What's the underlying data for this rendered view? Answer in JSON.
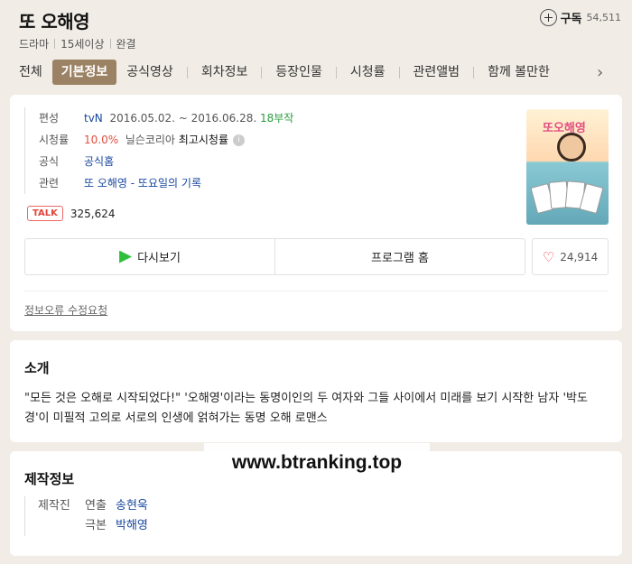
{
  "header": {
    "title": "또 오해영",
    "meta": [
      "드라마",
      "15세이상",
      "완결"
    ],
    "subscribe": {
      "label": "구독",
      "count": "54,511"
    }
  },
  "tabs": [
    "전체",
    "기본정보",
    "공식영상",
    "회차정보",
    "등장인물",
    "시청률",
    "관련앨범",
    "함께 볼만한"
  ],
  "active_tab": "기본정보",
  "info": {
    "broadcast": {
      "label": "편성",
      "channel": "tvN",
      "period": "2016.05.02. ~ 2016.06.28.",
      "episodes": "18부작"
    },
    "rating": {
      "label": "시청률",
      "value": "10.0%",
      "source": "닐슨코리아",
      "note": "최고시청률"
    },
    "official": {
      "label": "공식",
      "link": "공식홈"
    },
    "related": {
      "label": "관련",
      "link": "또 오해영 - 또요일의 기록"
    }
  },
  "talk": {
    "badge": "TALK",
    "count": "325,624"
  },
  "poster": {
    "title": "또오해영"
  },
  "actions": {
    "rewatch": "다시보기",
    "program_home": "프로그램 홈",
    "likes": "24,914"
  },
  "report_link": "정보오류 수정요청",
  "intro": {
    "title": "소개",
    "text": "\"모든 것은 오해로 시작되었다!\" '오해영'이라는 동명이인의 두 여자와 그들 사이에서 미래를 보기 시작한 남자 '박도경'이 미필적 고의로 서로의 인생에 얽혀가는 동명 오해 로맨스"
  },
  "production": {
    "title": "제작정보",
    "label": "제작진",
    "credits": [
      {
        "role": "연출",
        "name": "송현욱"
      },
      {
        "role": "극본",
        "name": "박해영"
      }
    ]
  },
  "watermark": "www.btranking.top",
  "colors": {
    "active_tab": "#9b8264",
    "link": "#17479e",
    "episodes": "#2a9b3e",
    "rating": "#e24f3d",
    "play": "#2fbf3c"
  }
}
